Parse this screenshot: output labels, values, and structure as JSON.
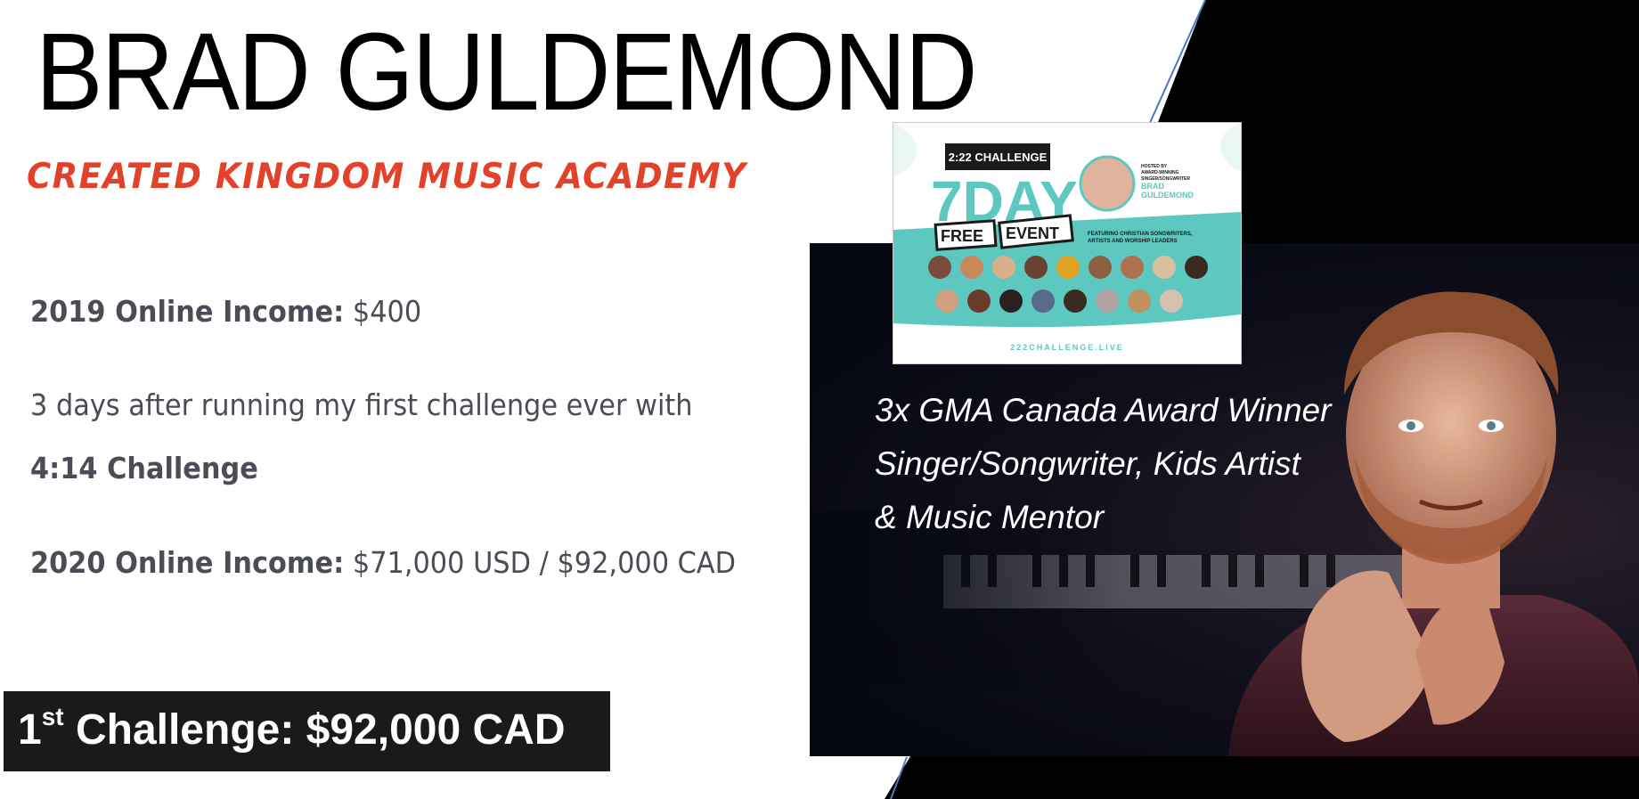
{
  "header": {
    "name": "BRAD GULDEMOND",
    "academy": "CREATED KINGDOM MUSIC ACADEMY"
  },
  "stats": {
    "income_2019_label": "2019 Online Income:",
    "income_2019_value": "$400",
    "challenge_line": "3 days after running my first challenge ever with",
    "challenge_name": "4:14 Challenge",
    "income_2020_label": "2020 Online Income:",
    "income_2020_value": "$71,000 USD / $92,000 CAD"
  },
  "badge": {
    "ordinal": "1",
    "ordinal_suffix": "st",
    "text": "Challenge: $92,000 CAD"
  },
  "photo": {
    "caption_lines": [
      "3x GMA Canada Award Winner",
      "Singer/Songwriter, Kids Artist",
      "& Music Mentor"
    ]
  },
  "flyer": {
    "tag": "2:22 CHALLENGE",
    "headline": "7DAY",
    "free": "FREE",
    "event": "EVENT",
    "hosted_by": "HOSTED BY",
    "award": "AWARD-WINNING",
    "role": "SINGER/SONGWRITER",
    "host_first": "BRAD",
    "host_last": "GULDEMOND",
    "featuring_1": "FEATURING CHRISTIAN SONGWRITERS,",
    "featuring_2": "ARTISTS AND WORSHIP LEADERS",
    "url": "222CHALLENGE.LIVE"
  },
  "colors": {
    "accent_red": "#e2412a",
    "teal": "#5cc8bf",
    "dark_bg": "#070914"
  }
}
